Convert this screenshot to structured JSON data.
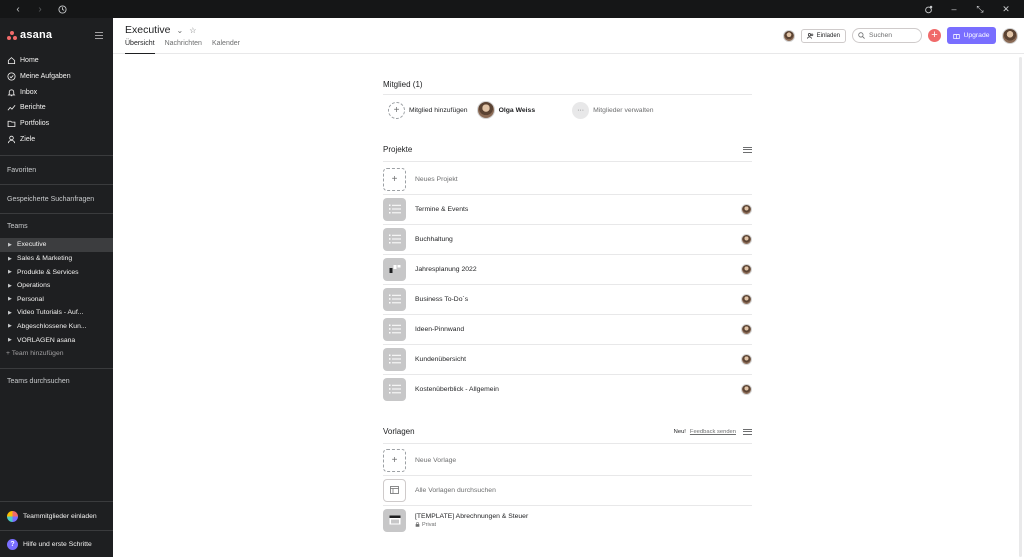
{
  "sidebar": {
    "logo": "asana",
    "nav": [
      {
        "label": "Home",
        "icon": "home-icon"
      },
      {
        "label": "Meine Aufgaben",
        "icon": "check-circle-icon"
      },
      {
        "label": "Inbox",
        "icon": "bell-icon"
      },
      {
        "label": "Berichte",
        "icon": "chart-line-icon"
      },
      {
        "label": "Portfolios",
        "icon": "folder-icon"
      },
      {
        "label": "Ziele",
        "icon": "person-icon"
      }
    ],
    "favorites": "Favoriten",
    "saved_searches": "Gespeicherte Suchanfragen",
    "teams_title": "Teams",
    "teams": [
      "Executive",
      "Sales & Marketing",
      "Produkte & Services",
      "Operations",
      "Personal",
      "Video Tutorials - Auf...",
      "Abgeschlossene Kun...",
      "VORLAGEN asana"
    ],
    "add_team": "+ Team hinzufügen",
    "browse_teams": "Teams durchsuchen",
    "invite_members": "Teammitglieder einladen",
    "help": "Hilfe und erste Schritte"
  },
  "header": {
    "title": "Executive",
    "tabs": [
      "Übersicht",
      "Nachrichten",
      "Kalender"
    ],
    "invite": "Einladen",
    "search_placeholder": "Suchen",
    "upgrade": "Upgrade"
  },
  "members": {
    "title": "Mitglied (1)",
    "add": "Mitglied hinzufügen",
    "member_name": "Olga Weiss",
    "manage": "Mitglieder verwalten"
  },
  "projects": {
    "title": "Projekte",
    "new": "Neues Projekt",
    "items": [
      {
        "name": "Termine & Events",
        "icon": "list-icon"
      },
      {
        "name": "Buchhaltung",
        "icon": "list-icon"
      },
      {
        "name": "Jahresplanung 2022",
        "icon": "board-icon"
      },
      {
        "name": "Business To-Do´s",
        "icon": "list-icon"
      },
      {
        "name": "Ideen-Pinnwand",
        "icon": "list-icon"
      },
      {
        "name": "Kundenübersicht",
        "icon": "list-icon"
      },
      {
        "name": "Kostenüberblick - Allgemein",
        "icon": "list-icon"
      }
    ]
  },
  "templates": {
    "title": "Vorlagen",
    "new_badge": "Neu!",
    "feedback": "Feedback senden",
    "new": "Neue Vorlage",
    "browse": "Alle Vorlagen durchsuchen",
    "item_name": "[TEMPLATE] Abrechnungen & Steuer",
    "item_visibility": "Privat"
  },
  "colors": {
    "sidebar_bg": "#1e1f21",
    "accent_red": "#f06a6a",
    "upgrade_purple": "#796eff",
    "tile_gray": "#c7c7c8"
  }
}
